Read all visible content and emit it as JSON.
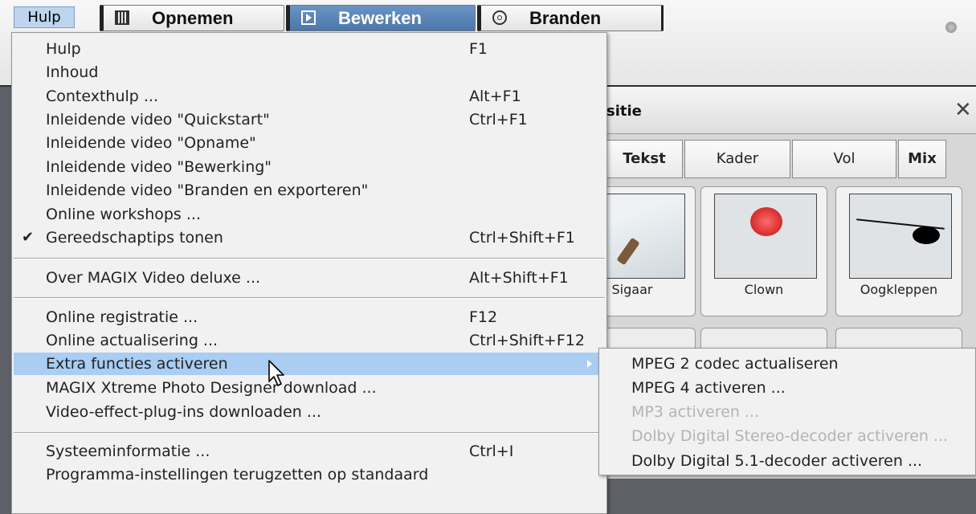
{
  "menubar": {
    "hulp_label": "Hulp",
    "tabs": [
      {
        "label": "Opnemen"
      },
      {
        "label": "Bewerken"
      },
      {
        "label": "Branden"
      }
    ]
  },
  "panel": {
    "title_partial": "sitie",
    "tabs": [
      "Tekst",
      "Kader",
      "Vol",
      "Mix"
    ],
    "tiles": [
      "Sigaar",
      "Clown",
      "Oogkleppen"
    ]
  },
  "menu": {
    "items": [
      {
        "label": "Hulp",
        "shortcut": "F1"
      },
      {
        "label": "Inhoud",
        "shortcut": ""
      },
      {
        "label": "Contexthulp ...",
        "shortcut": "Alt+F1"
      },
      {
        "label": "Inleidende video \"Quickstart\"",
        "shortcut": "Ctrl+F1"
      },
      {
        "label": "Inleidende video \"Opname\"",
        "shortcut": ""
      },
      {
        "label": "Inleidende video \"Bewerking\"",
        "shortcut": ""
      },
      {
        "label": "Inleidende video \"Branden en exporteren\"",
        "shortcut": ""
      },
      {
        "label": "Online workshops ...",
        "shortcut": ""
      },
      {
        "label": "Gereedschaptips tonen",
        "shortcut": "Ctrl+Shift+F1",
        "checked": true
      },
      {
        "label": "Over MAGIX Video deluxe ...",
        "shortcut": "Alt+Shift+F1"
      },
      {
        "label": "Online registratie ...",
        "shortcut": "F12"
      },
      {
        "label": "Online actualisering ...",
        "shortcut": "Ctrl+Shift+F12"
      },
      {
        "label": "Extra functies activeren",
        "shortcut": "",
        "highlighted": true,
        "has_submenu": true
      },
      {
        "label": "MAGIX Xtreme Photo Designer download ...",
        "shortcut": ""
      },
      {
        "label": "Video-effect-plug-ins downloaden ...",
        "shortcut": ""
      },
      {
        "label": "Systeeminformatie ...",
        "shortcut": "Ctrl+I"
      },
      {
        "label": "Programma-instellingen terugzetten op standaard",
        "shortcut": ""
      }
    ],
    "checkmark": "✔"
  },
  "submenu": {
    "items": [
      {
        "label": "MPEG 2 codec actualiseren",
        "enabled": true
      },
      {
        "label": "MPEG 4 activeren ...",
        "enabled": true
      },
      {
        "label": "MP3 activeren ...",
        "enabled": false
      },
      {
        "label": "Dolby Digital Stereo-decoder activeren ...",
        "enabled": false
      },
      {
        "label": "Dolby Digital 5.1-decoder activeren ...",
        "enabled": true
      }
    ]
  },
  "colors": {
    "highlight": "#a9cdf3",
    "active_tab": "#5b85b8",
    "menu_bg": "#f1f1f1",
    "disabled_text": "#b3b3b3"
  }
}
